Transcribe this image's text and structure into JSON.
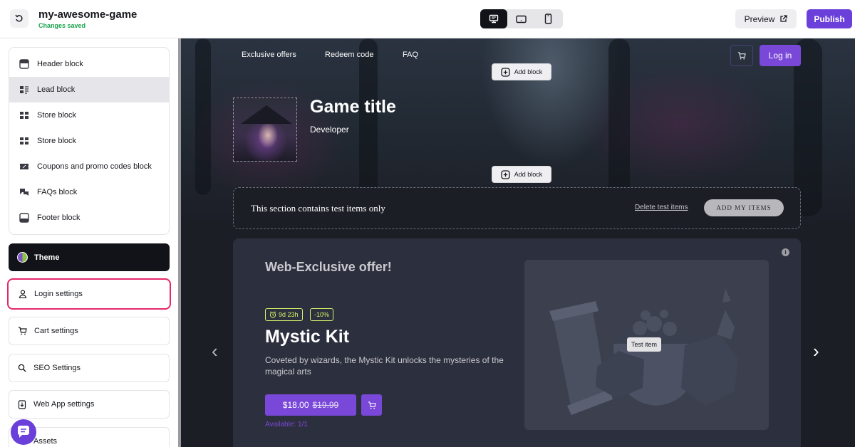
{
  "header": {
    "project_name": "my-awesome-game",
    "status": "Changes saved",
    "devices": [
      "desktop-icon",
      "tablet-icon",
      "mobile-icon"
    ],
    "active_device": "desktop",
    "preview_label": "Preview",
    "publish_label": "Publish"
  },
  "sidebar": {
    "blocks": [
      {
        "label": "Header block",
        "icon": "header-block-icon"
      },
      {
        "label": "Lead block",
        "icon": "lead-block-icon",
        "selected": true
      },
      {
        "label": "Store block",
        "icon": "store-block-icon"
      },
      {
        "label": "Store block",
        "icon": "store-block-icon"
      },
      {
        "label": "Coupons and promo codes block",
        "icon": "coupon-block-icon"
      },
      {
        "label": "FAQs block",
        "icon": "faq-block-icon"
      },
      {
        "label": "Footer block",
        "icon": "footer-block-icon"
      }
    ],
    "theme_label": "Theme",
    "settings": [
      {
        "label": "Login settings",
        "icon": "user-icon",
        "highlighted": true
      },
      {
        "label": "Cart settings",
        "icon": "cart-icon"
      },
      {
        "label": "SEO Settings",
        "icon": "search-icon"
      },
      {
        "label": "Web App settings",
        "icon": "download-icon"
      },
      {
        "label": "Assets",
        "icon": "assets-icon"
      }
    ]
  },
  "site": {
    "nav": [
      "Exclusive offers",
      "Redeem code",
      "FAQ"
    ],
    "login_label": "Log in",
    "add_block_label": "Add block",
    "game_title": "Game title",
    "developer": "Developer",
    "test_notice": "This section contains test items only",
    "delete_test_label": "Delete test items",
    "add_items_label": "ADD MY ITEMS",
    "offer": {
      "heading": "Web-Exclusive offer!",
      "timer": "9d 23h",
      "discount": "-10%",
      "name": "Mystic Kit",
      "description": "Coveted by wizards, the Mystic Kit unlocks the mysteries of the magical arts",
      "price": "$18.00",
      "old_price": "$19.99",
      "available": "Available: 1/1",
      "test_tag": "Test item"
    }
  },
  "colors": {
    "accent": "#6b3fd9",
    "highlight": "#e5266b",
    "timer_badge": "#d6f46b"
  }
}
